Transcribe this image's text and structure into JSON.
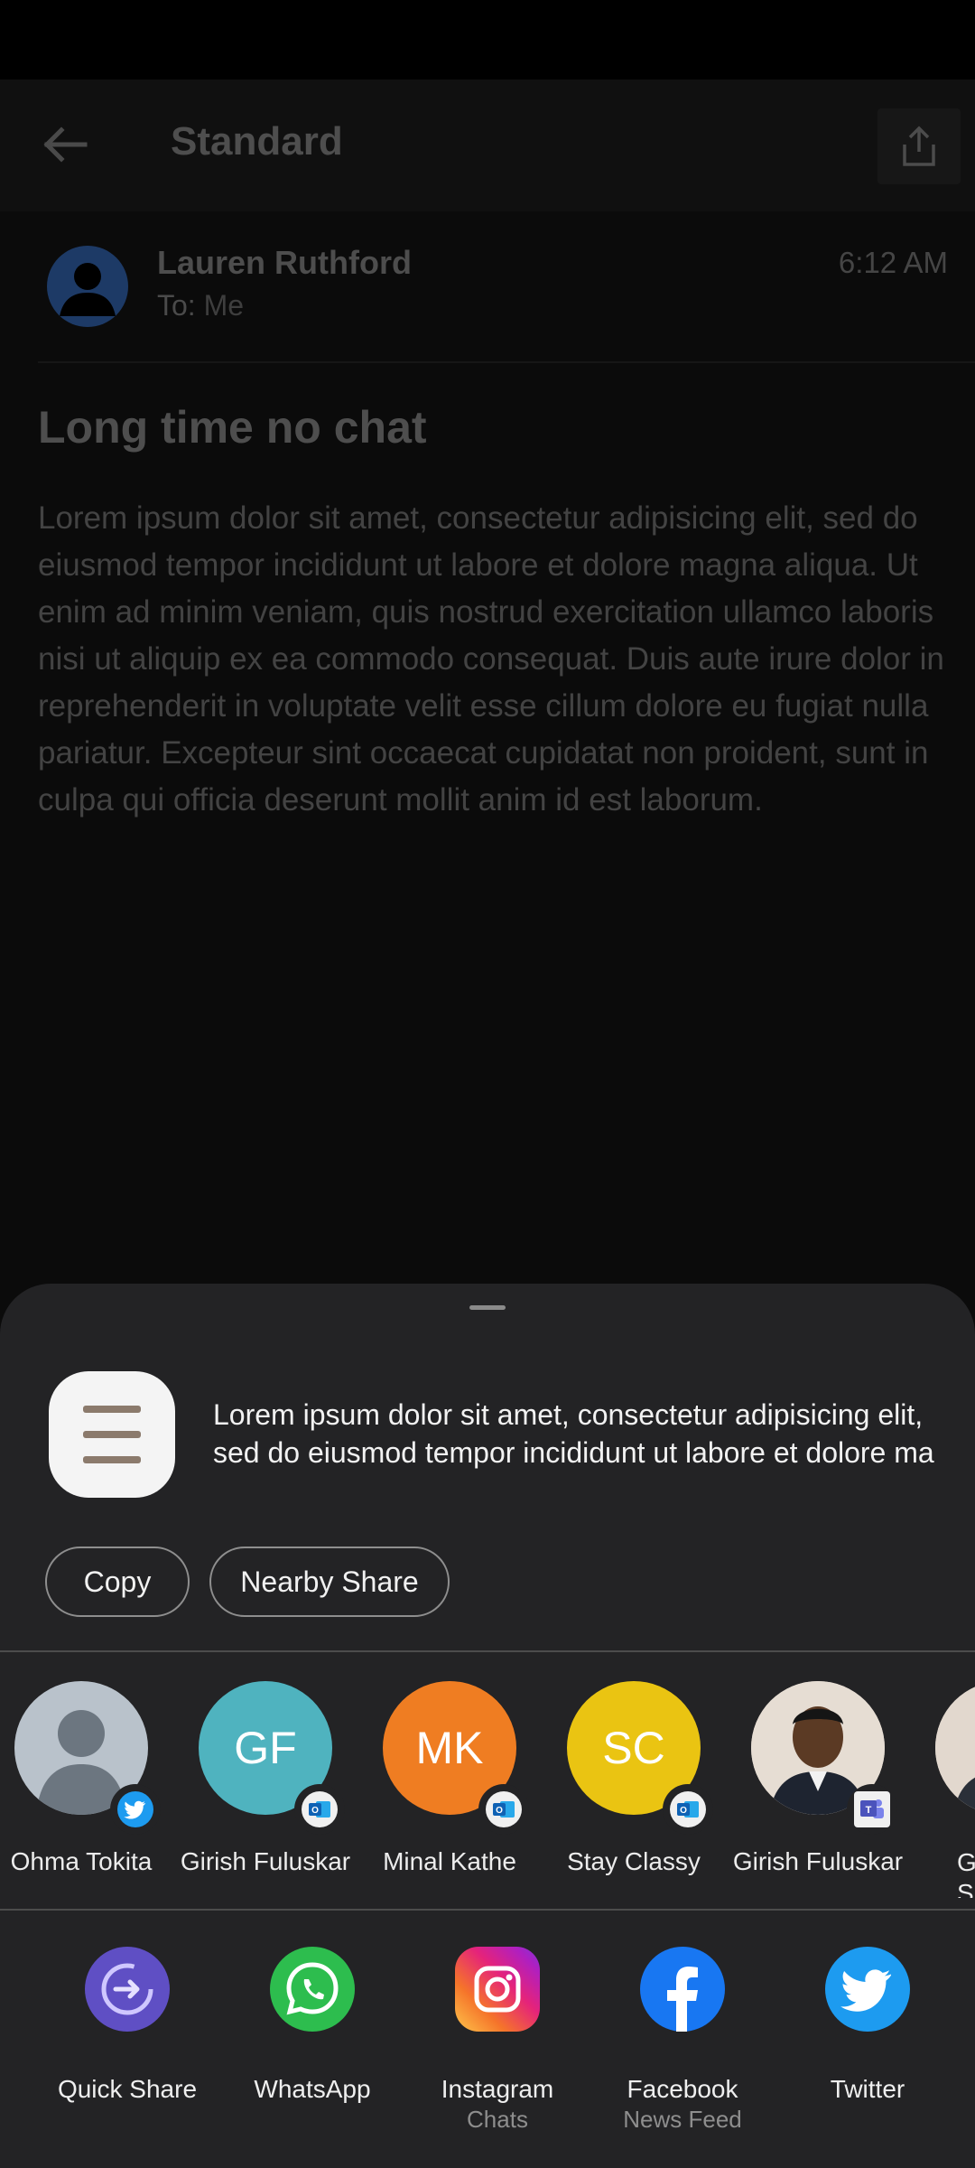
{
  "background_app": {
    "toolbar_title": "Standard",
    "sender_name": "Lauren Ruthford",
    "to_label": "To:",
    "to_value": "Me",
    "time": "6:12 AM",
    "subject": "Long time no chat",
    "body": "Lorem ipsum dolor sit amet, consectetur adipisicing elit, sed do eiusmod tempor incididunt ut labore et dolore magna aliqua. Ut enim ad minim veniam, quis nostrud exercitation ullamco laboris nisi ut aliquip ex ea commodo consequat. Duis aute irure dolor in reprehenderit in voluptate velit esse cillum dolore eu fugiat nulla pariatur. Excepteur sint occaecat cupidatat non proident, sunt in culpa qui officia deserunt mollit anim id est laborum."
  },
  "share_sheet": {
    "preview_line1": "Lorem ipsum dolor sit amet, consectetur adipisicing elit,",
    "preview_line2": "sed do eiusmod tempor incididunt ut labore et dolore ma...",
    "copy_label": "Copy",
    "nearby_label": "Nearby Share",
    "contacts": [
      {
        "name": "Ohma Tokita",
        "initials": "",
        "badge": "twitter-icon"
      },
      {
        "name": "Girish Fuluskar",
        "initials": "GF",
        "color": "#4fb3bf",
        "badge": "outlook-icon"
      },
      {
        "name": "Minal Kathe",
        "initials": "MK",
        "color": "#ef7d22",
        "badge": "outlook-icon"
      },
      {
        "name": "Stay Classy",
        "initials": "SC",
        "color": "#eac412",
        "badge": "outlook-icon"
      },
      {
        "name": "Girish Fuluskar",
        "initials": "",
        "badge": "teams-icon"
      },
      {
        "name": "Gi",
        "name2": "S",
        "initials": "",
        "badge": ""
      }
    ],
    "apps": [
      {
        "name": "Quick Share",
        "sub": ""
      },
      {
        "name": "WhatsApp",
        "sub": ""
      },
      {
        "name": "Instagram",
        "sub": "Chats"
      },
      {
        "name": "Facebook",
        "sub": "News Feed"
      },
      {
        "name": "Twitter",
        "sub": ""
      }
    ]
  },
  "colors": {
    "sheet_bg": "#232325",
    "quick_share": "#5f4fc4",
    "whatsapp": "#2dbd4e",
    "facebook": "#1877f2",
    "twitter": "#1d9bf0"
  }
}
